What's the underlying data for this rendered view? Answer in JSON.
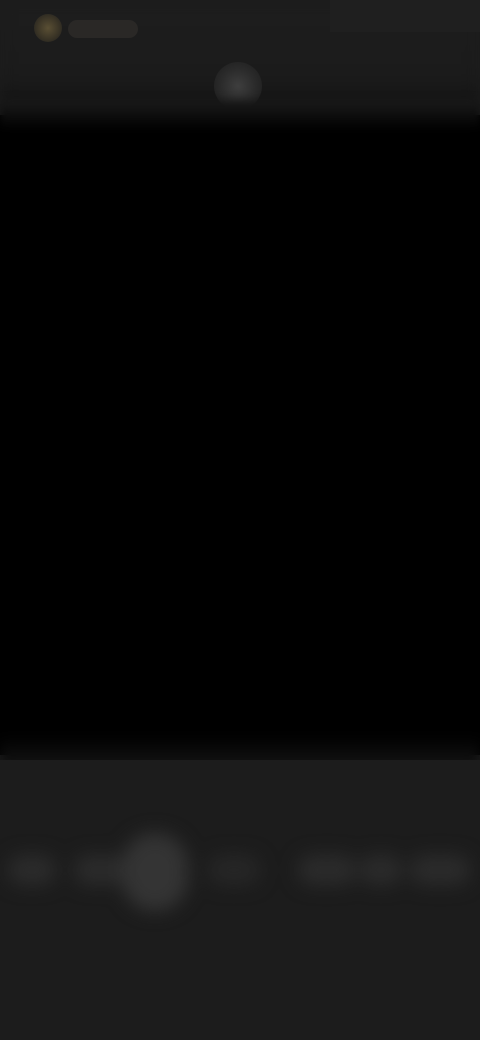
{
  "top_bar": {
    "flash_icon": "flash-icon",
    "flash_label": "",
    "status_icon": "camera-status-icon"
  },
  "viewfinder": {
    "state": "dark"
  },
  "mode_bar": {
    "items": [
      {
        "label": ""
      },
      {
        "label": ""
      },
      {
        "label": ""
      },
      {
        "label": ""
      },
      {
        "label": ""
      },
      {
        "label": ""
      },
      {
        "label": ""
      }
    ]
  },
  "colors": {
    "background": "#1c1c1c",
    "viewfinder": "#000000",
    "accent": "#5a4f34"
  }
}
